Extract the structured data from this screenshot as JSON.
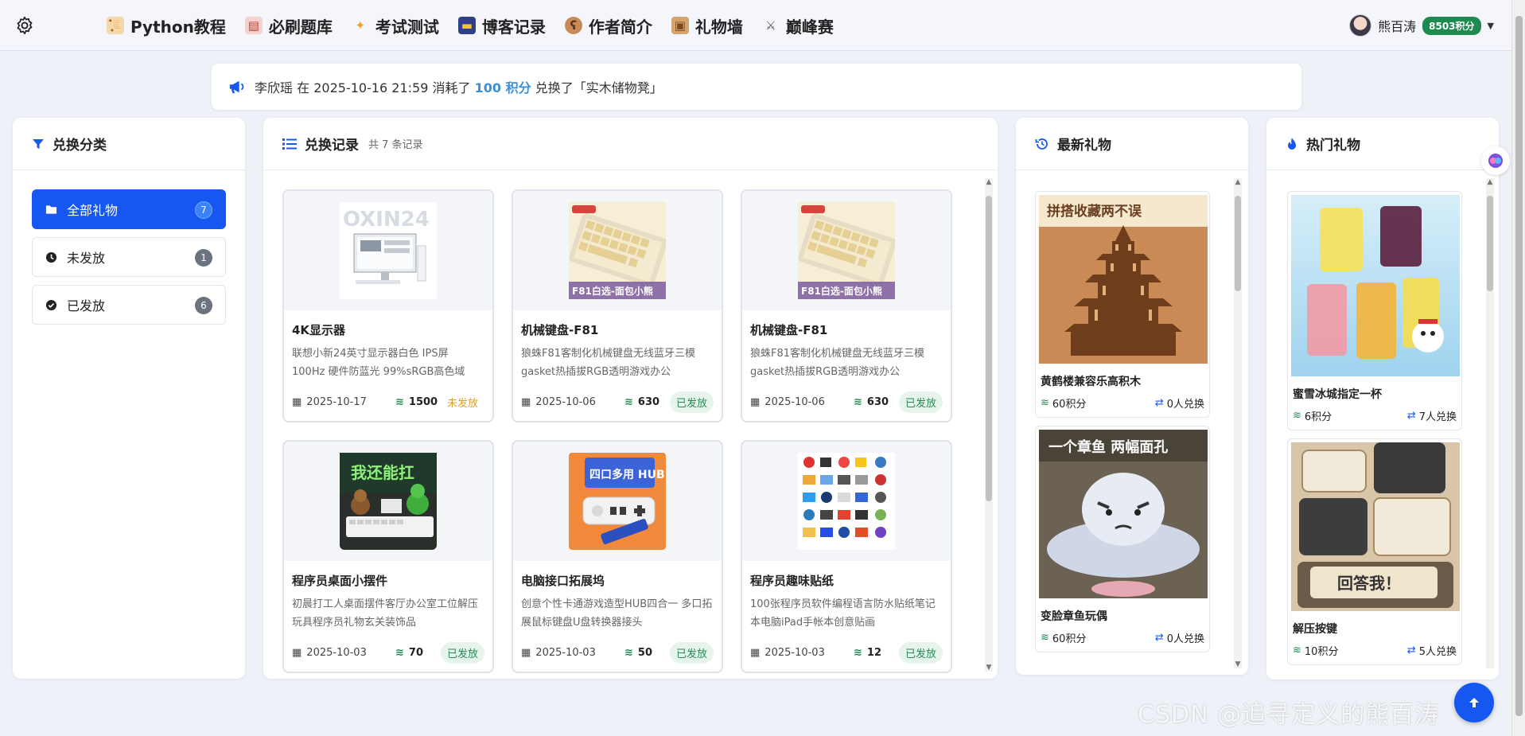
{
  "nav": {
    "items": [
      {
        "label": "Python教程",
        "icon": "scroll-icon",
        "color": "#c98a3a"
      },
      {
        "label": "必刷题库",
        "icon": "book-icon",
        "color": "#e0453a"
      },
      {
        "label": "考试测试",
        "icon": "sparkle-icon",
        "color": "#f0b030"
      },
      {
        "label": "博客记录",
        "icon": "notebook-icon",
        "color": "#2f3f8a"
      },
      {
        "label": "作者简介",
        "icon": "bear-icon",
        "color": "#8a5a3a"
      },
      {
        "label": "礼物墙",
        "icon": "package-icon",
        "color": "#b07a45"
      },
      {
        "label": "巅峰赛",
        "icon": "swords-icon",
        "color": "#555555"
      }
    ],
    "user_name": "熊百涛",
    "points_badge": "8503积分"
  },
  "notice": {
    "user": "李欣瑶",
    "at": "在",
    "time": "2025-10-16 21:59",
    "consumed": "消耗了",
    "points": "100 积分",
    "redeemed": "兑换了「实木储物凳」"
  },
  "categories": {
    "title": "兑换分类",
    "items": [
      {
        "label": "全部礼物",
        "count": "7",
        "icon": "folder-icon"
      },
      {
        "label": "未发放",
        "count": "1",
        "icon": "clock-icon"
      },
      {
        "label": "已发放",
        "count": "6",
        "icon": "check-circle-icon"
      }
    ]
  },
  "records": {
    "title": "兑换记录",
    "subtitle": "共 7 条记录",
    "cards": [
      {
        "title": "4K显示器",
        "desc": "联想小新24英寸显示器白色 IPS屏 100Hz 硬件防蓝光 99%sRGB高色域",
        "date": "2025-10-17",
        "points": "1500",
        "status": "未发放",
        "img": "monitor",
        "img_text": "OXIN24"
      },
      {
        "title": "机械键盘-F81",
        "desc": "狼蛛F81客制化机械键盘无线蓝牙三模gasket热插拔RGB透明游戏办公",
        "date": "2025-10-06",
        "points": "630",
        "status": "已发放",
        "img": "keyboard",
        "img_text": "F81白选-面包小熊"
      },
      {
        "title": "机械键盘-F81",
        "desc": "狼蛛F81客制化机械键盘无线蓝牙三模gasket热插拔RGB透明游戏办公",
        "date": "2025-10-06",
        "points": "630",
        "status": "已发放",
        "img": "keyboard",
        "img_text": "F81白选-面包小熊"
      },
      {
        "title": "程序员桌面小摆件",
        "desc": "初晨打工人桌面摆件客厅办公室工位解压玩具程序员礼物玄关装饰品",
        "date": "2025-10-03",
        "points": "70",
        "status": "已发放",
        "img": "desk",
        "img_text": "我还能扛"
      },
      {
        "title": "电脑接口拓展坞",
        "desc": "创意个性卡通游戏造型HUB四合一 多口拓展鼠标键盘U盘转换器接头",
        "date": "2025-10-03",
        "points": "50",
        "status": "已发放",
        "img": "hub",
        "img_text": "四口多用 HUB"
      },
      {
        "title": "程序员趣味贴纸",
        "desc": "100张程序员软件编程语言防水贴纸笔记本电脑iPad手帐本创意贴画",
        "date": "2025-10-03",
        "points": "12",
        "status": "已发放",
        "img": "stickers",
        "img_text": ""
      }
    ]
  },
  "latest": {
    "title": "最新礼物",
    "items": [
      {
        "name": "黄鹤楼兼容乐高积木",
        "points": "60积分",
        "exchanges": "0人兑换",
        "img": "tower",
        "img_text": "拼搭收藏两不误"
      },
      {
        "name": "变脸章鱼玩偶",
        "points": "60积分",
        "exchanges": "0人兑换",
        "img": "octopus",
        "img_text": "一个章鱼 两幅面孔"
      }
    ]
  },
  "hot": {
    "title": "热门礼物",
    "items": [
      {
        "name": "蜜雪冰城指定一杯",
        "points": "6积分",
        "exchanges": "7人兑换",
        "img": "drinks",
        "img_text": ""
      },
      {
        "name": "解压按键",
        "points": "10积分",
        "exchanges": "5人兑换",
        "img": "keycaps",
        "img_text": "回答我！"
      }
    ]
  },
  "watermark": "CSDN @追寻定义的熊百涛",
  "colors": {
    "primary": "#1557f0",
    "success": "#1d8a4f",
    "pending": "#d9a326",
    "highlight": "#3a8fd8"
  }
}
